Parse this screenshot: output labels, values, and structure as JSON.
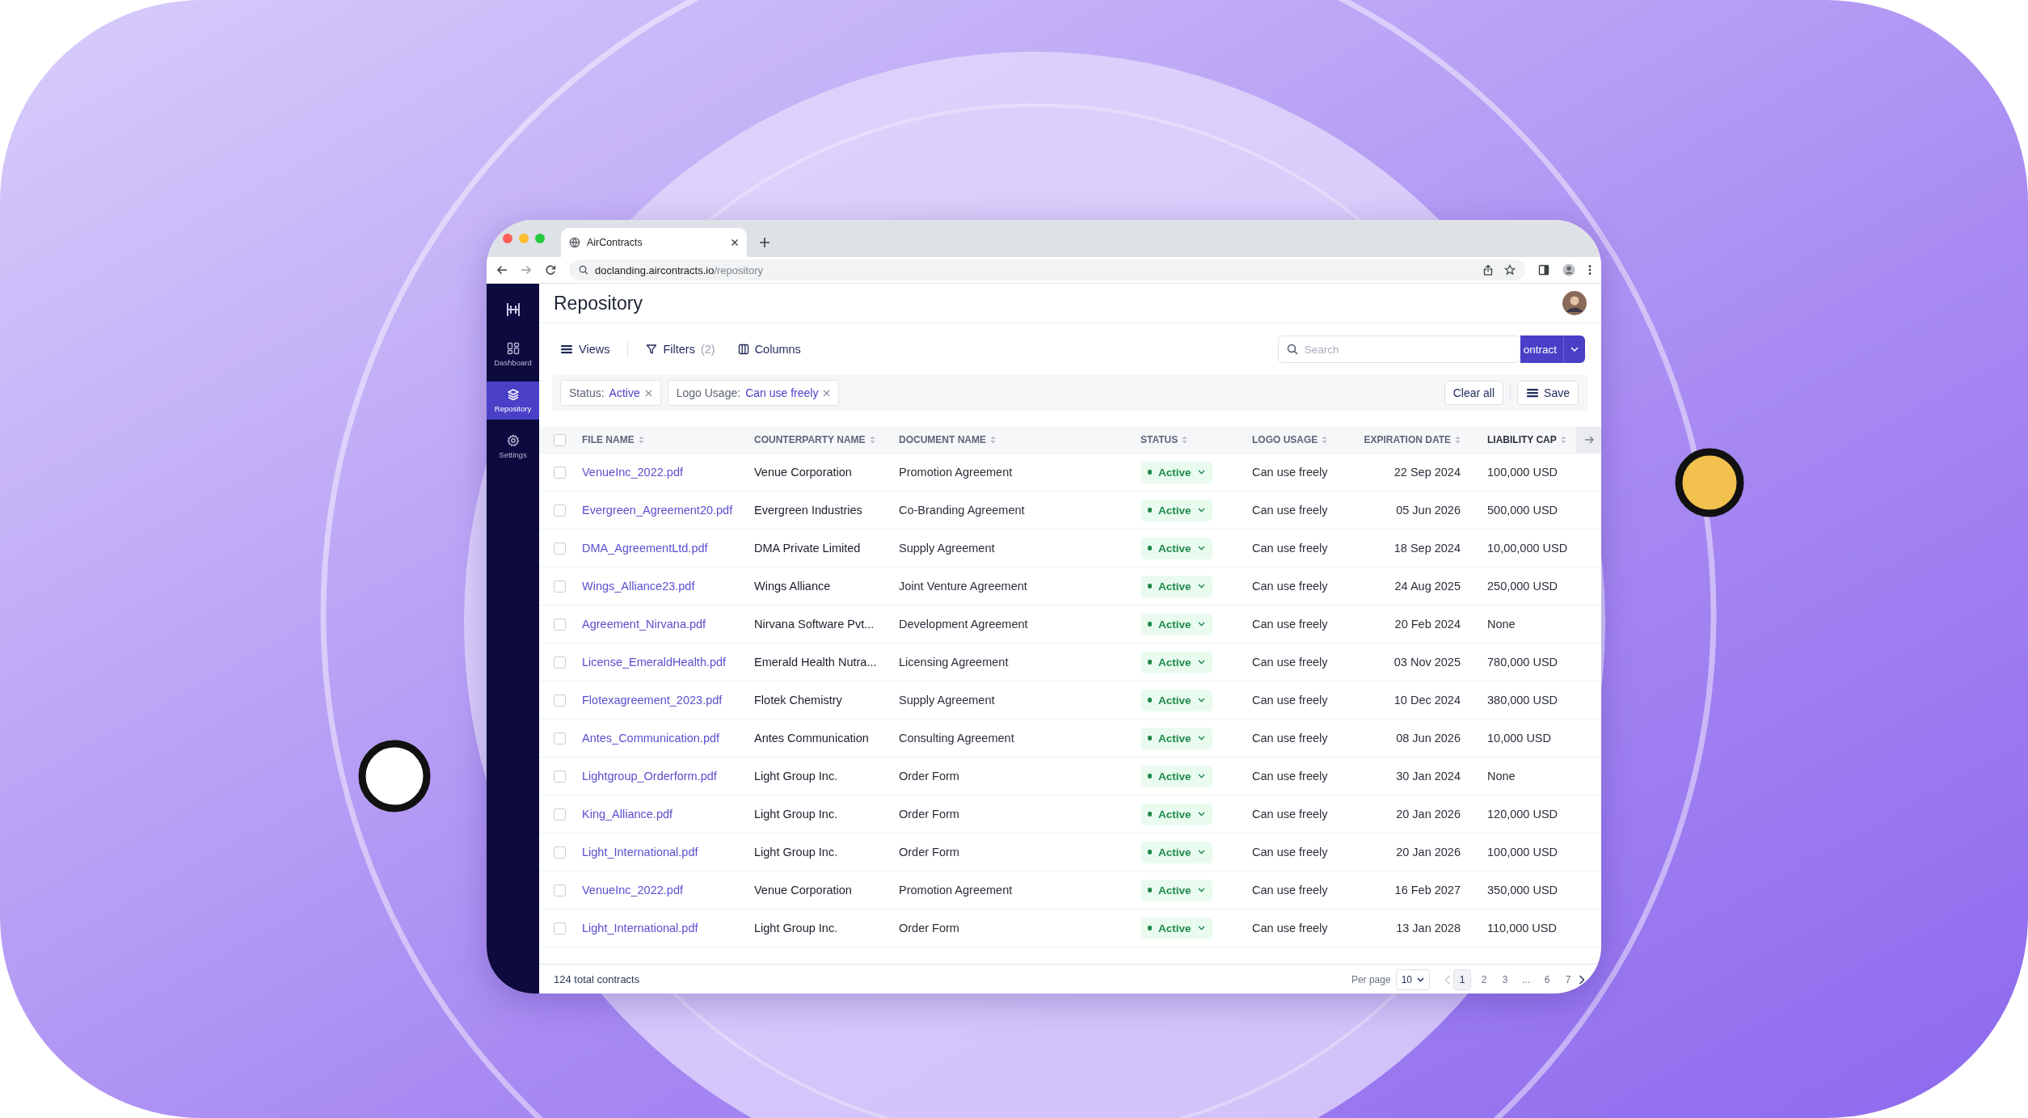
{
  "browser": {
    "tab_title": "AirContracts",
    "url_host": "doclanding.aircontracts.io",
    "url_path": "/repository"
  },
  "sidebar": {
    "items": [
      {
        "label": "Dashboard",
        "selected": false
      },
      {
        "label": "Repository",
        "selected": true
      },
      {
        "label": "Settings",
        "selected": false
      }
    ]
  },
  "page": {
    "title": "Repository"
  },
  "toolbar": {
    "items": [
      {
        "label": "Views"
      },
      {
        "label": "Filters",
        "count": "(2)"
      },
      {
        "label": "Columns"
      }
    ],
    "search": {
      "placeholder": "Search"
    },
    "primary_button": {
      "label": "ontract"
    }
  },
  "filters": {
    "chips": [
      {
        "field": "Status:",
        "value": "Active"
      },
      {
        "field": "Logo Usage:",
        "value": "Can use freely"
      }
    ],
    "clear_label": "Clear all",
    "save_label": "Save"
  },
  "table": {
    "all_checked": false,
    "columns": [
      {
        "label": "FILE NAME"
      },
      {
        "label": "COUNTERPARTY NAME"
      },
      {
        "label": "DOCUMENT NAME"
      },
      {
        "label": "STATUS"
      },
      {
        "label": "LOGO USAGE"
      },
      {
        "label": "EXPIRATION DATE"
      },
      {
        "label": "LIABILITY CAP"
      }
    ],
    "rows": [
      {
        "checked": false,
        "file": "VenueInc_2022.pdf",
        "counterparty": "Venue Corporation",
        "document": "Promotion Agreement",
        "status": "Active",
        "logo_usage": "Can use freely",
        "expiration": "22 Sep 2024",
        "liability": "100,000 USD"
      },
      {
        "checked": false,
        "file": "Evergreen_Agreement20.pdf",
        "counterparty": "Evergreen Industries",
        "document": "Co-Branding Agreement",
        "status": "Active",
        "logo_usage": "Can use freely",
        "expiration": "05 Jun 2026",
        "liability": "500,000 USD"
      },
      {
        "checked": false,
        "file": "DMA_AgreementLtd.pdf",
        "counterparty": "DMA Private Limited",
        "document": "Supply Agreement",
        "status": "Active",
        "logo_usage": "Can use freely",
        "expiration": "18 Sep 2024",
        "liability": "10,00,000 USD"
      },
      {
        "checked": false,
        "file": "Wings_Alliance23.pdf",
        "counterparty": "Wings Alliance",
        "document": "Joint Venture Agreement",
        "status": "Active",
        "logo_usage": "Can use freely",
        "expiration": "24 Aug 2025",
        "liability": "250,000 USD"
      },
      {
        "checked": false,
        "file": "Agreement_Nirvana.pdf",
        "counterparty": "Nirvana Software Pvt...",
        "document": "Development Agreement",
        "status": "Active",
        "logo_usage": "Can use freely",
        "expiration": "20 Feb 2024",
        "liability": "None"
      },
      {
        "checked": false,
        "file": "License_EmeraldHealth.pdf",
        "counterparty": "Emerald Health Nutra...",
        "document": "Licensing Agreement",
        "status": "Active",
        "logo_usage": "Can use freely",
        "expiration": "03 Nov 2025",
        "liability": "780,000 USD"
      },
      {
        "checked": false,
        "file": "Flotexagreement_2023.pdf",
        "counterparty": "Flotek Chemistry",
        "document": "Supply Agreement",
        "status": "Active",
        "logo_usage": "Can use freely",
        "expiration": "10 Dec 2024",
        "liability": "380,000 USD"
      },
      {
        "checked": false,
        "file": "Antes_Communication.pdf",
        "counterparty": "Antes Communication",
        "document": "Consulting Agreement",
        "status": "Active",
        "logo_usage": "Can use freely",
        "expiration": "08 Jun 2026",
        "liability": "10,000 USD"
      },
      {
        "checked": false,
        "file": "Lightgroup_Orderform.pdf",
        "counterparty": "Light Group Inc.",
        "document": "Order Form",
        "status": "Active",
        "logo_usage": "Can use freely",
        "expiration": "30 Jan 2024",
        "liability": "None"
      },
      {
        "checked": false,
        "file": "King_Alliance.pdf",
        "counterparty": "Light Group Inc.",
        "document": "Order Form",
        "status": "Active",
        "logo_usage": "Can use freely",
        "expiration": "20 Jan 2026",
        "liability": "120,000 USD"
      },
      {
        "checked": false,
        "file": "Light_International.pdf",
        "counterparty": "Light Group Inc.",
        "document": "Order Form",
        "status": "Active",
        "logo_usage": "Can use freely",
        "expiration": "20 Jan 2026",
        "liability": "100,000 USD"
      },
      {
        "checked": false,
        "file": "VenueInc_2022.pdf",
        "counterparty": "Venue Corporation",
        "document": "Promotion Agreement",
        "status": "Active",
        "logo_usage": "Can use freely",
        "expiration": "16 Feb 2027",
        "liability": "350,000 USD"
      },
      {
        "checked": false,
        "file": "Light_International.pdf",
        "counterparty": "Light Group Inc.",
        "document": "Order Form",
        "status": "Active",
        "logo_usage": "Can use freely",
        "expiration": "13 Jan 2028",
        "liability": "110,000 USD"
      }
    ]
  },
  "footer": {
    "total": "124 total contracts",
    "per_page_label": "Per page",
    "per_page": "10",
    "pages": [
      {
        "label": "1",
        "selected": true
      },
      {
        "label": "2",
        "selected": false
      },
      {
        "label": "3",
        "selected": false
      },
      {
        "label": "...",
        "selected": false
      },
      {
        "label": "6",
        "selected": false
      },
      {
        "label": "7",
        "selected": false
      }
    ]
  }
}
